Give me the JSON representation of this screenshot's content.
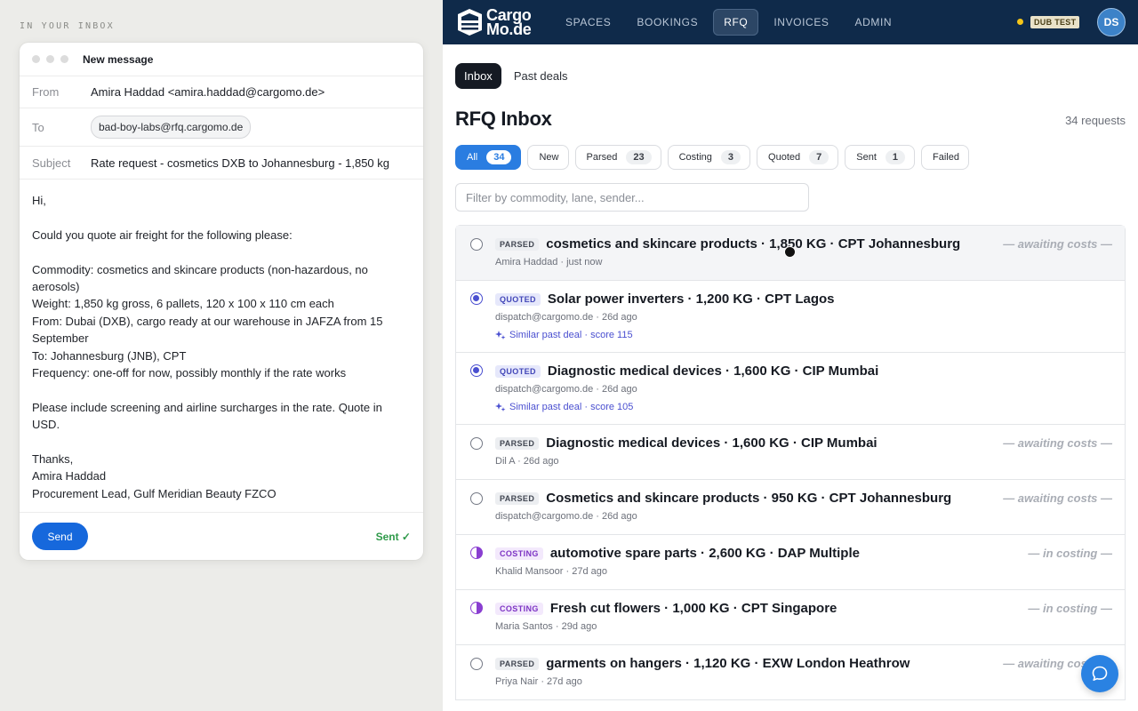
{
  "left": {
    "label": "IN YOUR INBOX",
    "compose": {
      "title": "New message",
      "from_label": "From",
      "from_value": "Amira Haddad <amira.haddad@cargomo.de>",
      "to_label": "To",
      "to_value": "bad-boy-labs@rfq.cargomo.de",
      "subject_label": "Subject",
      "subject_value": "Rate request - cosmetics DXB to Johannesburg - 1,850 kg",
      "body": [
        "Hi,",
        "Could you quote air freight for the following please:",
        "Commodity: cosmetics and skincare products (non-hazardous, no aerosols)\nWeight: 1,850 kg gross, 6 pallets, 120 x 100 x 110 cm each\nFrom: Dubai (DXB), cargo ready at our warehouse in JAFZA from 15 September\nTo: Johannesburg (JNB), CPT\nFrequency: one-off for now, possibly monthly if the rate works",
        "Please include screening and airline surcharges in the rate. Quote in USD.",
        "Thanks,\nAmira Haddad\nProcurement Lead, Gulf Meridian Beauty FZCO"
      ],
      "send_label": "Send",
      "sent_status": "Sent ✓"
    }
  },
  "app": {
    "logo_line1": "Cargo",
    "logo_line2": "Mo.de",
    "nav": [
      "SPACES",
      "BOOKINGS",
      "RFQ",
      "INVOICES",
      "ADMIN"
    ],
    "nav_active": "RFQ",
    "env_badge": "DUB TEST",
    "avatar": "DS",
    "accent": "#2a7de1",
    "subtabs": [
      "Inbox",
      "Past deals"
    ],
    "page_title": "RFQ Inbox",
    "request_count": "34 requests",
    "filters": [
      {
        "label": "All",
        "count": "34"
      },
      {
        "label": "New",
        "count": ""
      },
      {
        "label": "Parsed",
        "count": "23"
      },
      {
        "label": "Costing",
        "count": "3"
      },
      {
        "label": "Quoted",
        "count": "7"
      },
      {
        "label": "Sent",
        "count": "1"
      },
      {
        "label": "Failed",
        "count": ""
      }
    ],
    "search_placeholder": "Filter by commodity, lane, sender...",
    "rows": [
      {
        "status": "PARSED",
        "title": "cosmetics and skincare products · 1,850 KG · CPT Johannesburg",
        "meta": "Amira Haddad · just now",
        "right": "— awaiting costs —",
        "similar": ""
      },
      {
        "status": "QUOTED",
        "title": "Solar power inverters · 1,200 KG · CPT Lagos",
        "meta": "dispatch@cargomo.de · 26d ago",
        "right": "",
        "similar": "Similar past deal · score 115"
      },
      {
        "status": "QUOTED",
        "title": "Diagnostic medical devices · 1,600 KG · CIP Mumbai",
        "meta": "dispatch@cargomo.de · 26d ago",
        "right": "",
        "similar": "Similar past deal · score 105"
      },
      {
        "status": "PARSED",
        "title": "Diagnostic medical devices · 1,600 KG · CIP Mumbai",
        "meta": "Dil A · 26d ago",
        "right": "— awaiting costs —",
        "similar": ""
      },
      {
        "status": "PARSED",
        "title": "Cosmetics and skincare products · 950 KG · CPT Johannesburg",
        "meta": "dispatch@cargomo.de · 26d ago",
        "right": "— awaiting costs —",
        "similar": ""
      },
      {
        "status": "COSTING",
        "title": "automotive spare parts · 2,600 KG · DAP Multiple",
        "meta": "Khalid Mansoor · 27d ago",
        "right": "— in costing —",
        "similar": ""
      },
      {
        "status": "COSTING",
        "title": "Fresh cut flowers · 1,000 KG · CPT Singapore",
        "meta": "Maria Santos · 29d ago",
        "right": "— in costing —",
        "similar": ""
      },
      {
        "status": "PARSED",
        "title": "garments on hangers · 1,120 KG · EXW London Heathrow",
        "meta": "Priya Nair · 27d ago",
        "right": "— awaiting costs —",
        "similar": ""
      }
    ]
  }
}
